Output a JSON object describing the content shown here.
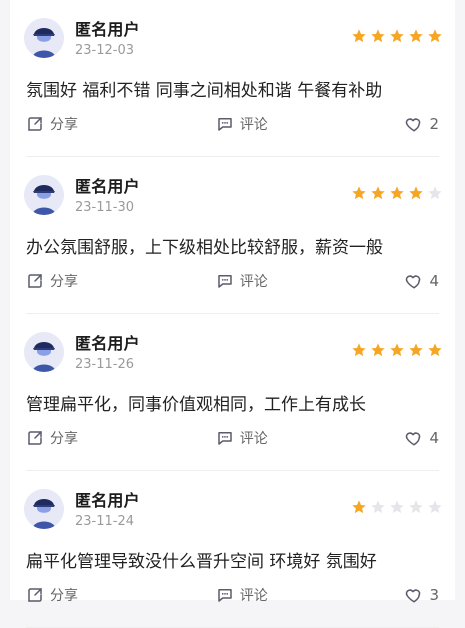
{
  "reviews": [
    {
      "username": "匿名用户",
      "date": "23-12-03",
      "rating": 5,
      "content": "氛围好 福利不错 同事之间相处和谐 午餐有补助",
      "actions": {
        "share": "分享",
        "comment": "评论",
        "likes": "2"
      }
    },
    {
      "username": "匿名用户",
      "date": "23-11-30",
      "rating": 4,
      "content": "办公氛围舒服，上下级相处比较舒服，薪资一般",
      "actions": {
        "share": "分享",
        "comment": "评论",
        "likes": "4"
      }
    },
    {
      "username": "匿名用户",
      "date": "23-11-26",
      "rating": 5,
      "content": "管理扁平化，同事价值观相同，工作上有成长",
      "actions": {
        "share": "分享",
        "comment": "评论",
        "likes": "4"
      }
    },
    {
      "username": "匿名用户",
      "date": "23-11-24",
      "rating": 1,
      "content": "扁平化管理导致没什么晋升空间 环境好 氛围好",
      "actions": {
        "share": "分享",
        "comment": "评论",
        "likes": "3"
      }
    }
  ],
  "colors": {
    "star_filled": "#f6a623",
    "star_empty": "#e6e6ea",
    "icon": "#5b5b6b",
    "avatar_bg": "#e7e9f7"
  },
  "icons": {
    "avatar": "anonymous-hat-avatar-icon",
    "share": "share-icon",
    "comment": "comment-icon",
    "like": "heart-icon"
  }
}
